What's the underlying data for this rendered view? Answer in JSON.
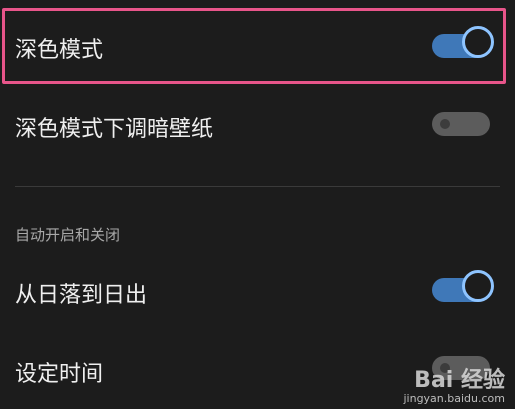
{
  "settings": {
    "dark_mode": {
      "label": "深色模式",
      "enabled": true
    },
    "dim_wallpaper": {
      "label": "深色模式下调暗壁纸",
      "enabled": false
    },
    "section_title": "自动开启和关闭",
    "sunset_sunrise": {
      "label": "从日落到日出",
      "enabled": true
    },
    "set_time": {
      "label": "设定时间",
      "enabled": false
    }
  },
  "watermark": {
    "brand": "Bai 经验",
    "domain": "jingyan.baidu.com"
  },
  "colors": {
    "accent": "#3f78b8",
    "knob_ring": "#8ec4ff",
    "highlight": "#e8558a",
    "background": "#1c1c1c"
  }
}
